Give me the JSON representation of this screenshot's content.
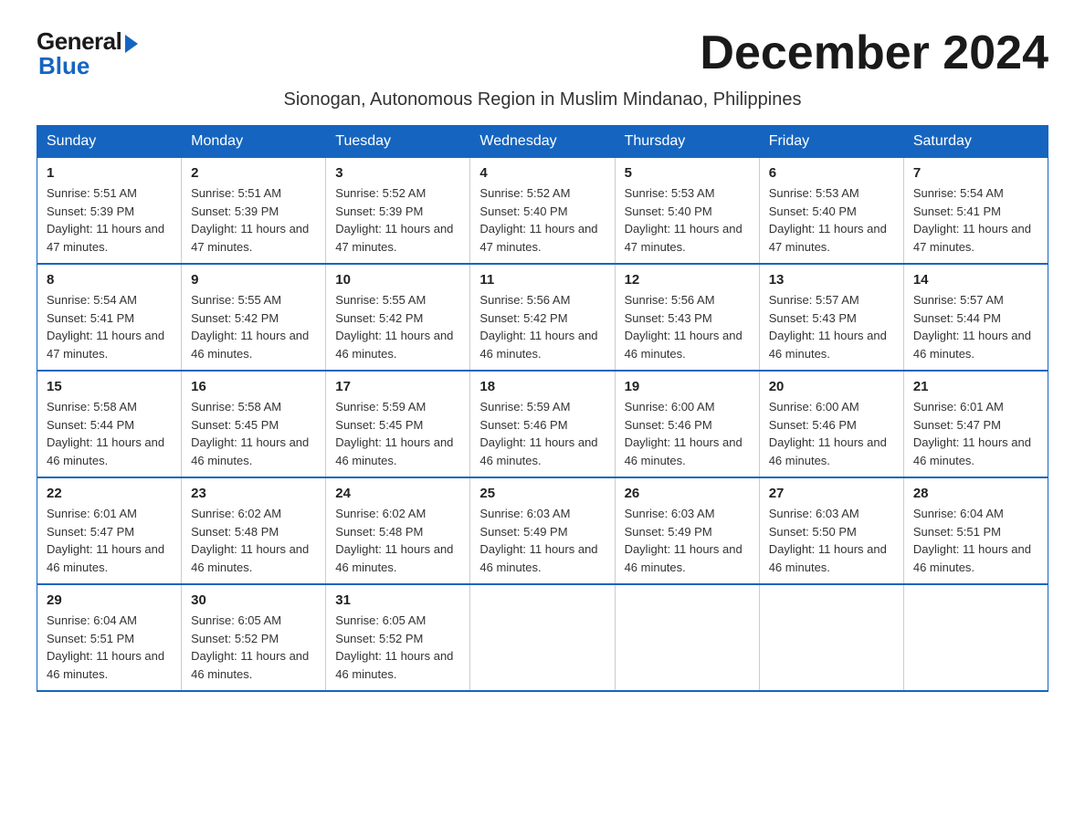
{
  "logo": {
    "general": "General",
    "blue": "Blue"
  },
  "title": "December 2024",
  "subtitle": "Sionogan, Autonomous Region in Muslim Mindanao, Philippines",
  "days_of_week": [
    "Sunday",
    "Monday",
    "Tuesday",
    "Wednesday",
    "Thursday",
    "Friday",
    "Saturday"
  ],
  "weeks": [
    [
      {
        "day": "1",
        "sunrise": "5:51 AM",
        "sunset": "5:39 PM",
        "daylight": "11 hours and 47 minutes."
      },
      {
        "day": "2",
        "sunrise": "5:51 AM",
        "sunset": "5:39 PM",
        "daylight": "11 hours and 47 minutes."
      },
      {
        "day": "3",
        "sunrise": "5:52 AM",
        "sunset": "5:39 PM",
        "daylight": "11 hours and 47 minutes."
      },
      {
        "day": "4",
        "sunrise": "5:52 AM",
        "sunset": "5:40 PM",
        "daylight": "11 hours and 47 minutes."
      },
      {
        "day": "5",
        "sunrise": "5:53 AM",
        "sunset": "5:40 PM",
        "daylight": "11 hours and 47 minutes."
      },
      {
        "day": "6",
        "sunrise": "5:53 AM",
        "sunset": "5:40 PM",
        "daylight": "11 hours and 47 minutes."
      },
      {
        "day": "7",
        "sunrise": "5:54 AM",
        "sunset": "5:41 PM",
        "daylight": "11 hours and 47 minutes."
      }
    ],
    [
      {
        "day": "8",
        "sunrise": "5:54 AM",
        "sunset": "5:41 PM",
        "daylight": "11 hours and 47 minutes."
      },
      {
        "day": "9",
        "sunrise": "5:55 AM",
        "sunset": "5:42 PM",
        "daylight": "11 hours and 46 minutes."
      },
      {
        "day": "10",
        "sunrise": "5:55 AM",
        "sunset": "5:42 PM",
        "daylight": "11 hours and 46 minutes."
      },
      {
        "day": "11",
        "sunrise": "5:56 AM",
        "sunset": "5:42 PM",
        "daylight": "11 hours and 46 minutes."
      },
      {
        "day": "12",
        "sunrise": "5:56 AM",
        "sunset": "5:43 PM",
        "daylight": "11 hours and 46 minutes."
      },
      {
        "day": "13",
        "sunrise": "5:57 AM",
        "sunset": "5:43 PM",
        "daylight": "11 hours and 46 minutes."
      },
      {
        "day": "14",
        "sunrise": "5:57 AM",
        "sunset": "5:44 PM",
        "daylight": "11 hours and 46 minutes."
      }
    ],
    [
      {
        "day": "15",
        "sunrise": "5:58 AM",
        "sunset": "5:44 PM",
        "daylight": "11 hours and 46 minutes."
      },
      {
        "day": "16",
        "sunrise": "5:58 AM",
        "sunset": "5:45 PM",
        "daylight": "11 hours and 46 minutes."
      },
      {
        "day": "17",
        "sunrise": "5:59 AM",
        "sunset": "5:45 PM",
        "daylight": "11 hours and 46 minutes."
      },
      {
        "day": "18",
        "sunrise": "5:59 AM",
        "sunset": "5:46 PM",
        "daylight": "11 hours and 46 minutes."
      },
      {
        "day": "19",
        "sunrise": "6:00 AM",
        "sunset": "5:46 PM",
        "daylight": "11 hours and 46 minutes."
      },
      {
        "day": "20",
        "sunrise": "6:00 AM",
        "sunset": "5:46 PM",
        "daylight": "11 hours and 46 minutes."
      },
      {
        "day": "21",
        "sunrise": "6:01 AM",
        "sunset": "5:47 PM",
        "daylight": "11 hours and 46 minutes."
      }
    ],
    [
      {
        "day": "22",
        "sunrise": "6:01 AM",
        "sunset": "5:47 PM",
        "daylight": "11 hours and 46 minutes."
      },
      {
        "day": "23",
        "sunrise": "6:02 AM",
        "sunset": "5:48 PM",
        "daylight": "11 hours and 46 minutes."
      },
      {
        "day": "24",
        "sunrise": "6:02 AM",
        "sunset": "5:48 PM",
        "daylight": "11 hours and 46 minutes."
      },
      {
        "day": "25",
        "sunrise": "6:03 AM",
        "sunset": "5:49 PM",
        "daylight": "11 hours and 46 minutes."
      },
      {
        "day": "26",
        "sunrise": "6:03 AM",
        "sunset": "5:49 PM",
        "daylight": "11 hours and 46 minutes."
      },
      {
        "day": "27",
        "sunrise": "6:03 AM",
        "sunset": "5:50 PM",
        "daylight": "11 hours and 46 minutes."
      },
      {
        "day": "28",
        "sunrise": "6:04 AM",
        "sunset": "5:51 PM",
        "daylight": "11 hours and 46 minutes."
      }
    ],
    [
      {
        "day": "29",
        "sunrise": "6:04 AM",
        "sunset": "5:51 PM",
        "daylight": "11 hours and 46 minutes."
      },
      {
        "day": "30",
        "sunrise": "6:05 AM",
        "sunset": "5:52 PM",
        "daylight": "11 hours and 46 minutes."
      },
      {
        "day": "31",
        "sunrise": "6:05 AM",
        "sunset": "5:52 PM",
        "daylight": "11 hours and 46 minutes."
      },
      null,
      null,
      null,
      null
    ]
  ]
}
